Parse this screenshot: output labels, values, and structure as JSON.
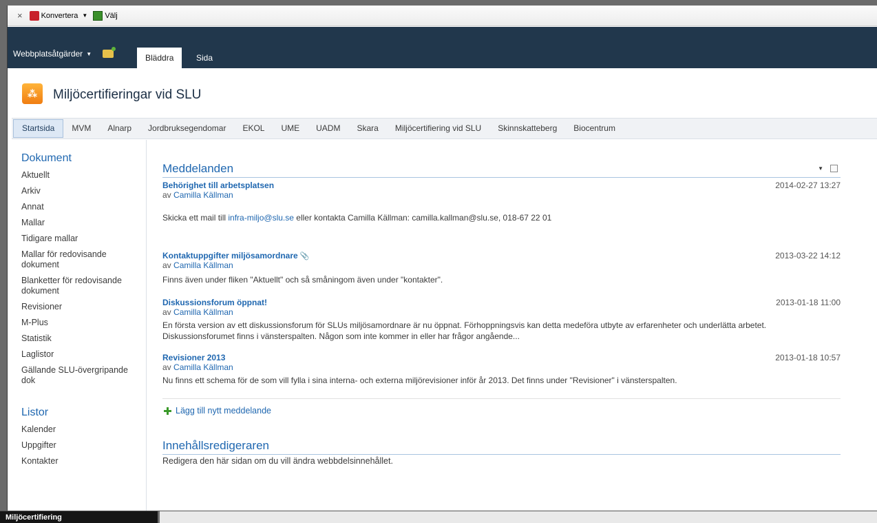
{
  "acrobat": {
    "convert_label": "Konvertera",
    "select_label": "Välj"
  },
  "ribbon": {
    "site_actions": "Webbplatsåtgärder",
    "tabs": [
      "Bläddra",
      "Sida"
    ]
  },
  "site": {
    "title": "Miljöcertifieringar vid SLU"
  },
  "topnav": [
    "Startsida",
    "MVM",
    "Alnarp",
    "Jordbruksegendomar",
    "EKOL",
    "UME",
    "UADM",
    "Skara",
    "Miljöcertifiering vid SLU",
    "Skinnskatteberg",
    "Biocentrum"
  ],
  "sidebar": {
    "documents_heading": "Dokument",
    "documents": [
      "Aktuellt",
      "Arkiv",
      "Annat",
      "Mallar",
      "Tidigare mallar",
      "Mallar för redovisande dokument",
      "Blanketter för redovisande dokument",
      "Revisioner",
      "M-Plus",
      "Statistik",
      "Laglistor",
      "Gällande SLU-övergripande dok"
    ],
    "lists_heading": "Listor",
    "lists": [
      "Kalender",
      "Uppgifter",
      "Kontakter"
    ]
  },
  "announcements": {
    "heading": "Meddelanden",
    "author_prefix": "av",
    "items": [
      {
        "title": "Behörighet till arbetsplatsen",
        "author": "Camilla Källman",
        "date": "2014-02-27 13:27",
        "body_pre": "Skicka ett mail till",
        "body_link": "infra-miljo@slu.se",
        "body_post": "eller kontakta Camilla Källman: camilla.kallman@slu.se, 018-67 22 01"
      },
      {
        "title": "Kontaktuppgifter miljösamordnare",
        "author": "Camilla Källman",
        "date": "2013-03-22 14:12",
        "body": "Finns även under fliken \"Aktuellt\" och så småningom även under \"kontakter\"."
      },
      {
        "title": "Diskussionsforum öppnat!",
        "author": "Camilla Källman",
        "date": "2013-01-18 11:00",
        "body": "En första version av ett diskussionsforum för SLUs miljösamordnare är nu öppnat. Förhoppningsvis kan detta medeföra utbyte av erfarenheter och underlätta arbetet. Diskussionsforumet finns i vänsterspalten. Någon som inte kommer in eller har frågor angående..."
      },
      {
        "title": "Revisioner 2013",
        "author": "Camilla Källman",
        "date": "2013-01-18 10:57",
        "body": "Nu finns ett schema för de som vill fylla i sina interna- och externa miljörevisioner inför år 2013. Det finns under \"Revisioner\" i vänsterspalten."
      }
    ],
    "add_label": "Lägg till nytt meddelande"
  },
  "editor": {
    "heading": "Innehållsredigeraren",
    "text": "Redigera den här sidan om du vill ändra webbdelsinnehållet."
  },
  "taskbar": {
    "label": "Miljöcertifiering"
  },
  "colors": {
    "ribbon": "#21374c",
    "link": "#1f67b0",
    "nav_bg": "#f0f2f5",
    "logo": "#f59a22"
  }
}
